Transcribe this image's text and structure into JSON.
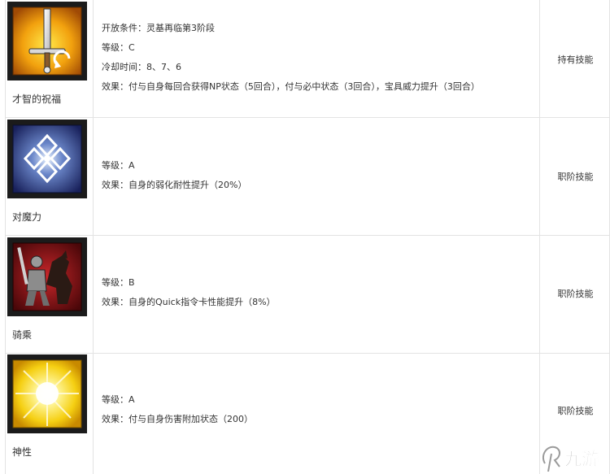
{
  "skills": [
    {
      "name": "才智的祝福",
      "icon": "sword-blessing-icon",
      "lines": [
        "开放条件：灵基再临第3阶段",
        "等级：C",
        "冷却时间：8、7、6",
        "效果：付与自身每回合获得NP状态（5回合），付与必中状态（3回合），宝具威力提升（3回合）"
      ],
      "type": "持有技能"
    },
    {
      "name": "对魔力",
      "icon": "magic-resistance-icon",
      "lines": [
        "等级：A",
        "效果：自身的弱化耐性提升（20%）"
      ],
      "type": "职阶技能"
    },
    {
      "name": "骑乘",
      "icon": "riding-knight-icon",
      "lines": [
        "等级：B",
        "效果：自身的Quick指令卡性能提升（8%）"
      ],
      "type": "职阶技能"
    },
    {
      "name": "神性",
      "icon": "divinity-sun-icon",
      "lines": [
        "等级：A",
        "效果：付与自身伤害附加状态（200）"
      ],
      "type": "职阶技能"
    }
  ],
  "watermark": {
    "text": "九游",
    "icon": "jiuyou-logo-icon"
  }
}
